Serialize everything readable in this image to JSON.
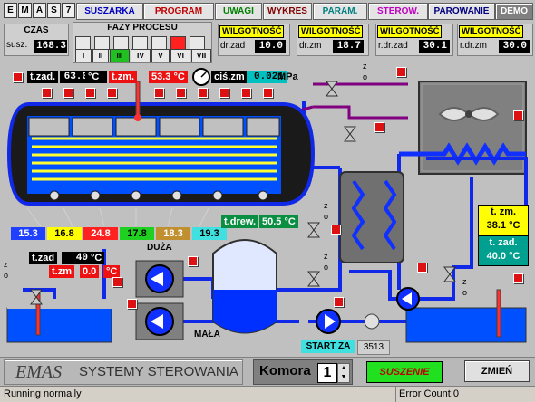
{
  "header": {
    "logo_letters": [
      "E",
      "M",
      "A",
      "S",
      "7"
    ],
    "tabs": [
      {
        "label": "SUSZARKA",
        "color": "#0000c0"
      },
      {
        "label": "PROGRAM",
        "color": "#c00000"
      },
      {
        "label": "UWAGI",
        "color": "#008000"
      },
      {
        "label": "WYKRES",
        "color": "#800000"
      },
      {
        "label": "PARAM.",
        "color": "#008080"
      },
      {
        "label": "STEROW.",
        "color": "#c000c0"
      },
      {
        "label": "PAROWANIE",
        "color": "#000080"
      },
      {
        "label": "DEMO",
        "color": "#ffffff"
      }
    ]
  },
  "time": {
    "title": "CZAS",
    "label": "susz.",
    "value": "168.3"
  },
  "phases": {
    "title": "FAZY PROCESU",
    "buttons": [
      "I",
      "II",
      "III",
      "IV",
      "V",
      "VI",
      "VII"
    ],
    "active_index": 2,
    "active_marker_index": 5
  },
  "humidity": [
    {
      "title": "WILGOTNOŚĆ",
      "label": "dr.zad",
      "value": "10.0"
    },
    {
      "title": "WILGOTNOŚĆ",
      "label": "dr.zm",
      "value": "18.7"
    },
    {
      "title": "WILGOTNOŚĆ",
      "label": "r.dr.zad",
      "value": "30.1"
    },
    {
      "title": "WILGOTNOŚĆ",
      "label": "r.dr.zm",
      "value": "30.0"
    }
  ],
  "chamber": {
    "t_zad_label": "t.zad.",
    "t_zad_value": "63.0",
    "unit_c": "°C",
    "t_zm_label": "t.zm.",
    "t_zm_value": "53.3 °C",
    "pressure_label": "ciś.zm",
    "pressure_value": "0.021",
    "pressure_unit": "MPa"
  },
  "wood_temps": [
    {
      "value": "15.3",
      "color": "#2040ff",
      "text": "#ffffff"
    },
    {
      "value": "16.8",
      "color": "#ffff00",
      "text": "#000000"
    },
    {
      "value": "24.8",
      "color": "#ff2020",
      "text": "#ffffff"
    },
    {
      "value": "17.8",
      "color": "#20d020",
      "text": "#000000"
    },
    {
      "value": "18.3",
      "color": "#c09030",
      "text": "#ffffff"
    },
    {
      "value": "19.3",
      "color": "#40e0e0",
      "text": "#000000"
    }
  ],
  "wood_temp_main": {
    "label": "t.drew.",
    "value": "50.5 °C"
  },
  "condenser": {
    "t_zm_label": "t. zm.",
    "t_zm_value": "38.1",
    "t_zad_label": "t. zad.",
    "t_zad_value": "40.0",
    "unit": "°C"
  },
  "lower_tank": {
    "t_zad_label": "t.zad",
    "t_zad_value": "40",
    "t_zm_label": "t.zm",
    "t_zm_value": "0.0",
    "unit": "°C"
  },
  "pumps": {
    "big_label": "DUŻA",
    "small_label": "MAŁA"
  },
  "valve_marks": {
    "z": "z",
    "o": "o"
  },
  "start": {
    "label": "START ZA",
    "value": "3513"
  },
  "footer": {
    "logo": "EMAS",
    "company": "SYSTEMY STEROWANIA",
    "komora_label": "Komora",
    "komora_value": "1",
    "mode": "SUSZENIE",
    "change_button": "ZMIEŃ"
  },
  "status": {
    "left": "Running normally",
    "right": "Error Count:0"
  }
}
